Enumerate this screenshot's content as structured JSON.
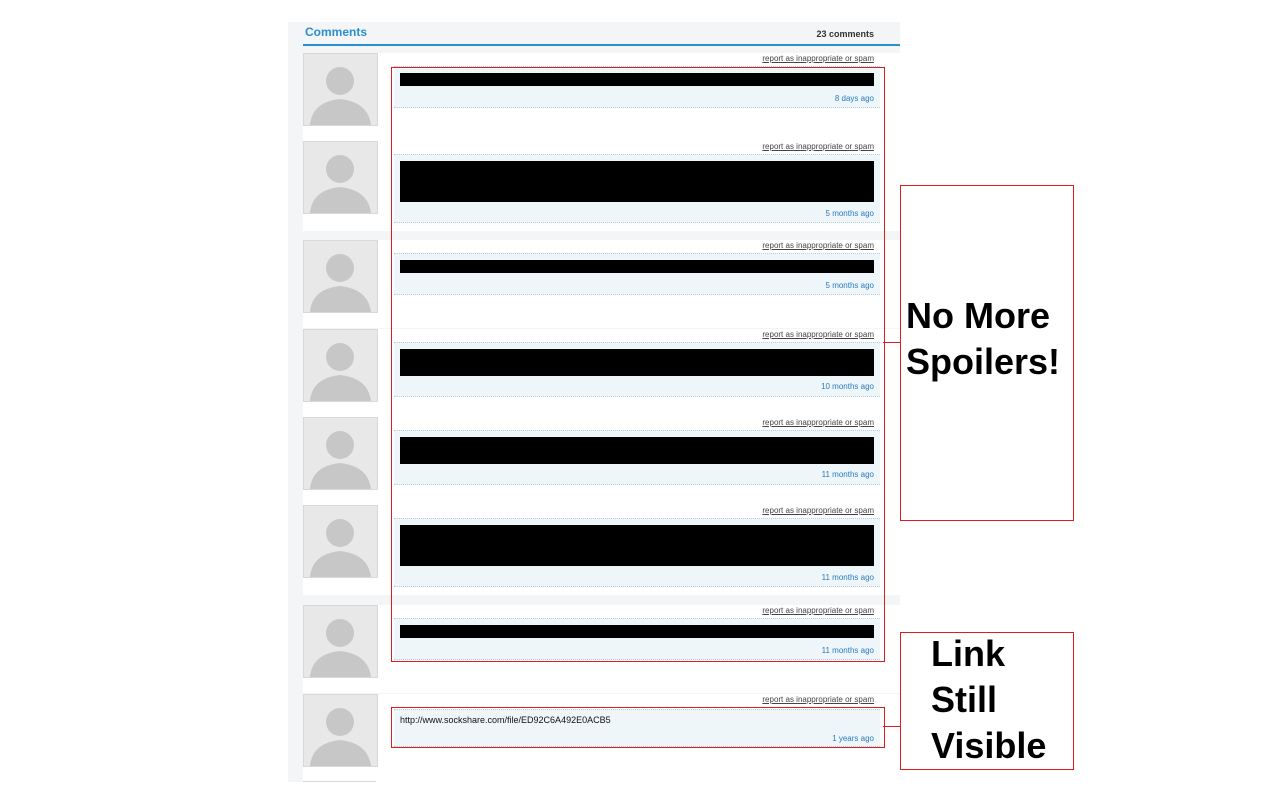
{
  "header": {
    "title": "Comments",
    "count": "23 comments"
  },
  "report_label": "report as inappropriate or spam",
  "comments": [
    {
      "time": "8 days ago",
      "redacted": true
    },
    {
      "time": "5 months ago",
      "redacted": true
    },
    {
      "time": "5 months ago",
      "redacted": true
    },
    {
      "time": "10 months ago",
      "redacted": true
    },
    {
      "time": "11 months ago",
      "redacted": true
    },
    {
      "time": "11 months ago",
      "redacted": true
    },
    {
      "time": "11 months ago",
      "redacted": true
    },
    {
      "time": "1 years ago",
      "redacted": false,
      "text": "http://www.sockshare.com/file/ED92C6A492E0ACB5"
    }
  ],
  "annotations": {
    "spoilers": {
      "line1": "No More",
      "line2": "Spoilers!"
    },
    "link": {
      "line1": "Link",
      "line2": "Still",
      "line3": "Visible"
    }
  },
  "colors": {
    "accent": "#2a8fd0",
    "annotation_red": "#e01b1b",
    "comment_bg": "#eef6f9"
  },
  "icons": {
    "avatar": "default-user-silhouette-icon"
  }
}
